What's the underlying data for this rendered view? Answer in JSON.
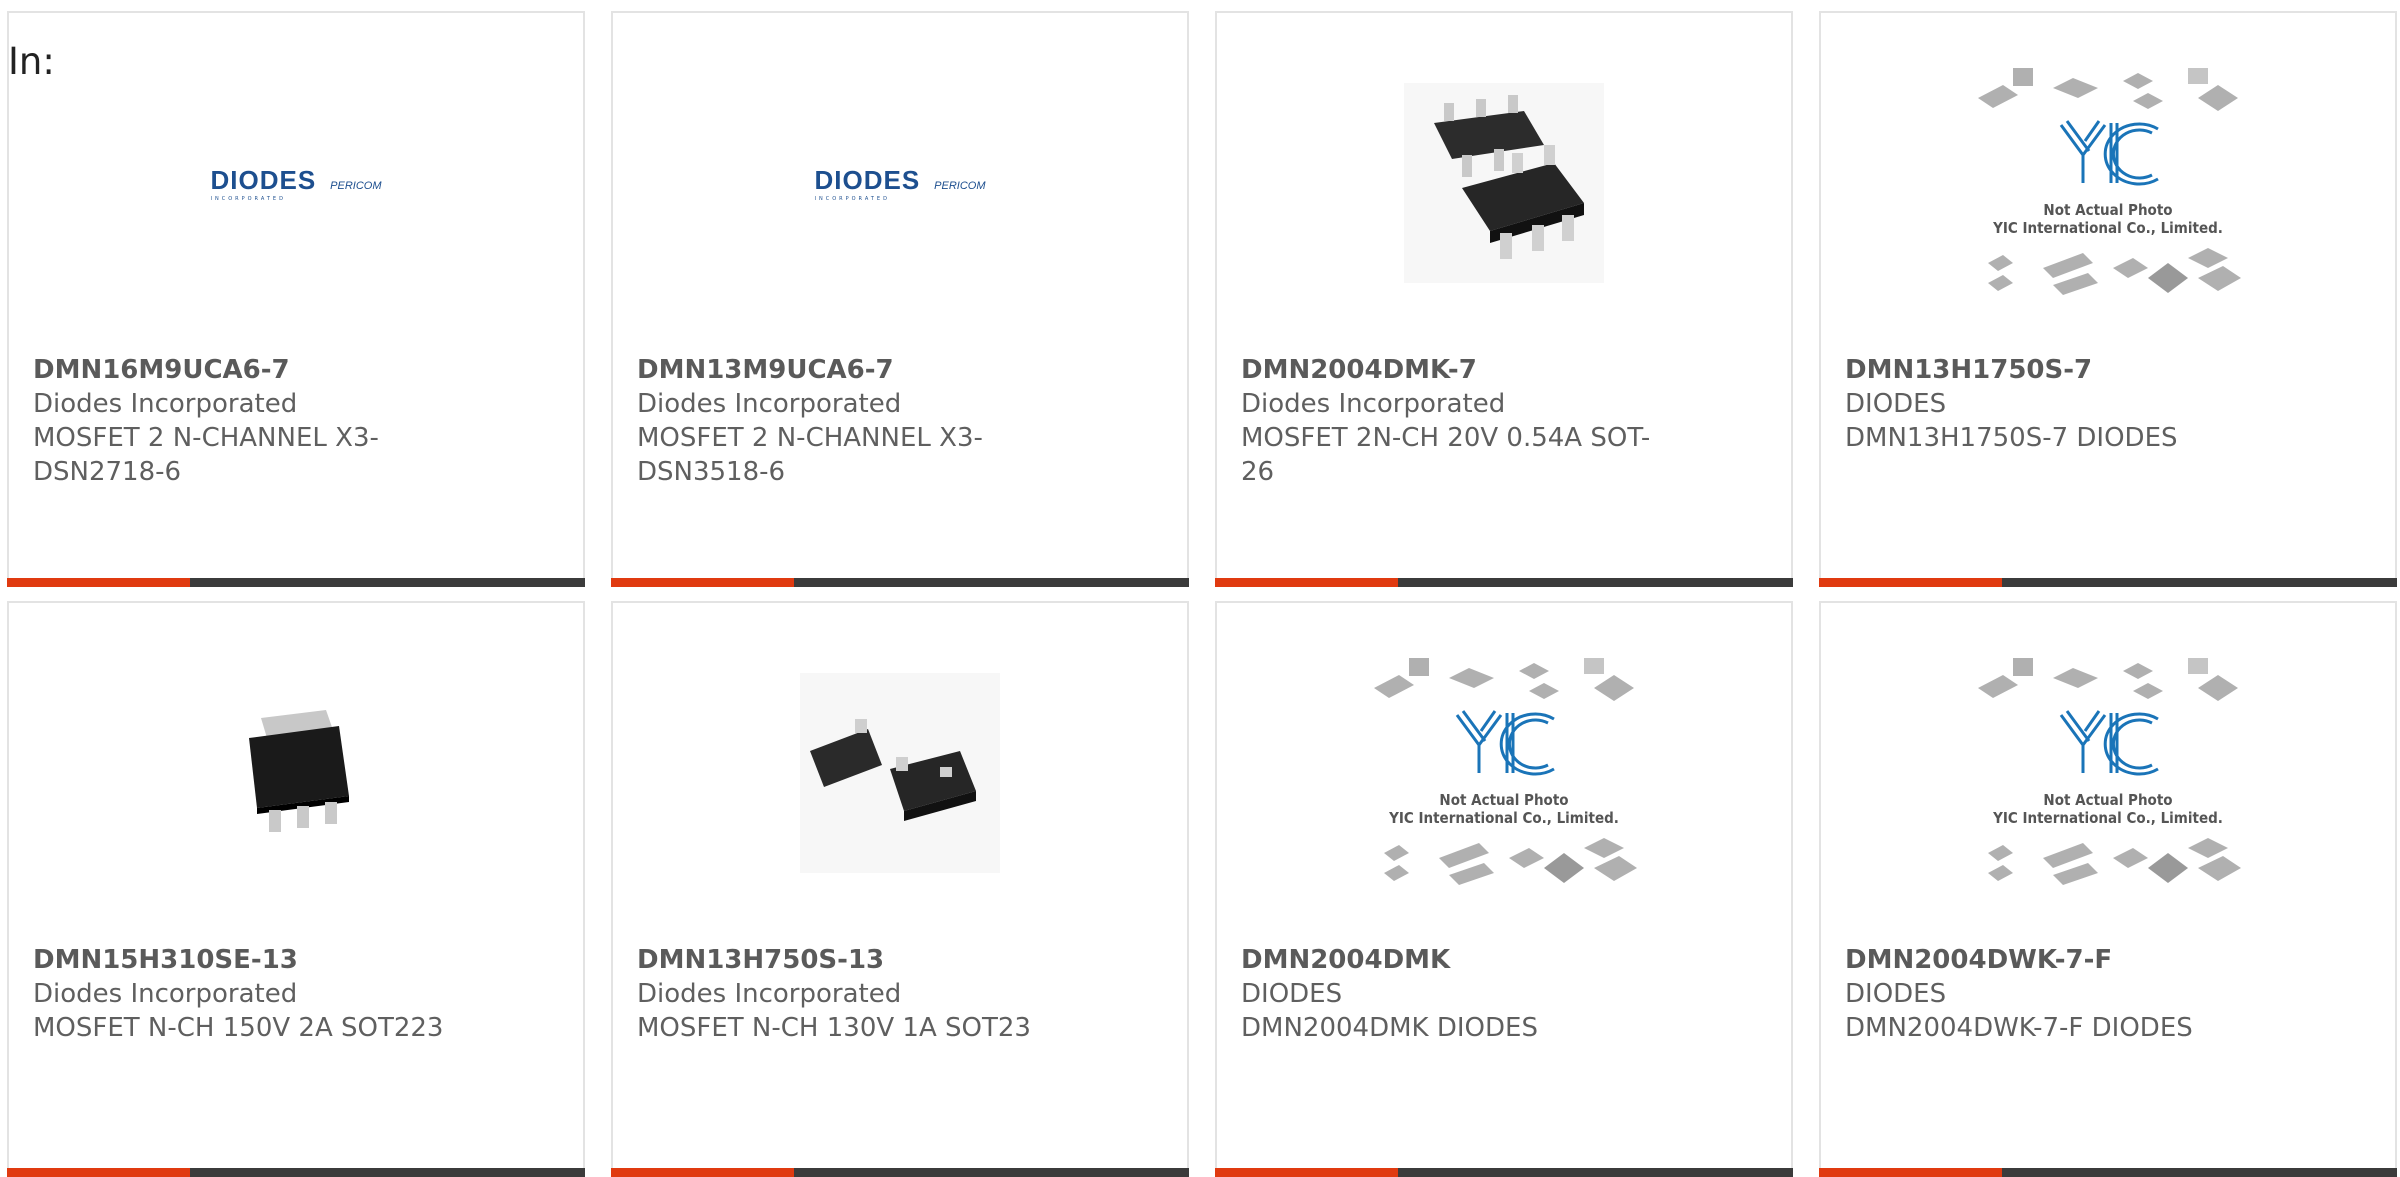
{
  "grid_label": "In:",
  "colors": {
    "accent": "#e03a10",
    "bar_dark": "#3b3b3b",
    "diodes_blue": "#1d4f8f",
    "yic_blue": "#1a74b8"
  },
  "placeholder": {
    "line1": "Not Actual Photo",
    "line2": "YIC International Co., Limited.",
    "logo": "YIC"
  },
  "logo": {
    "diodes": "DIODES",
    "pericom": "PERICOM"
  },
  "products": [
    {
      "part_number": "DMN16M9UCA6-7",
      "manufacturer": "Diodes Incorporated",
      "description": "MOSFET 2 N-CHANNEL X3-DSN2718-6",
      "image": "diodes-logo"
    },
    {
      "part_number": "DMN13M9UCA6-7",
      "manufacturer": "Diodes Incorporated",
      "description": "MOSFET 2 N-CHANNEL X3-DSN3518-6",
      "image": "diodes-logo"
    },
    {
      "part_number": "DMN2004DMK-7",
      "manufacturer": "Diodes Incorporated",
      "description": "MOSFET 2N-CH 20V 0.54A SOT-26",
      "image": "sot26-chip"
    },
    {
      "part_number": "DMN13H1750S-7",
      "manufacturer": "DIODES",
      "description": "DMN13H1750S-7 DIODES",
      "image": "yic-placeholder"
    },
    {
      "part_number": "DMN15H310SE-13",
      "manufacturer": "Diodes Incorporated",
      "description": "MOSFET N-CH 150V 2A SOT223",
      "image": "sot223-chip"
    },
    {
      "part_number": "DMN13H750S-13",
      "manufacturer": "Diodes Incorporated",
      "description": "MOSFET N-CH 130V 1A SOT23",
      "image": "sot23-chip"
    },
    {
      "part_number": "DMN2004DMK",
      "manufacturer": "DIODES",
      "description": "DMN2004DMK DIODES",
      "image": "yic-placeholder"
    },
    {
      "part_number": "DMN2004DWK-7-F",
      "manufacturer": "DIODES",
      "description": "DMN2004DWK-7-F DIODES",
      "image": "yic-placeholder"
    }
  ]
}
